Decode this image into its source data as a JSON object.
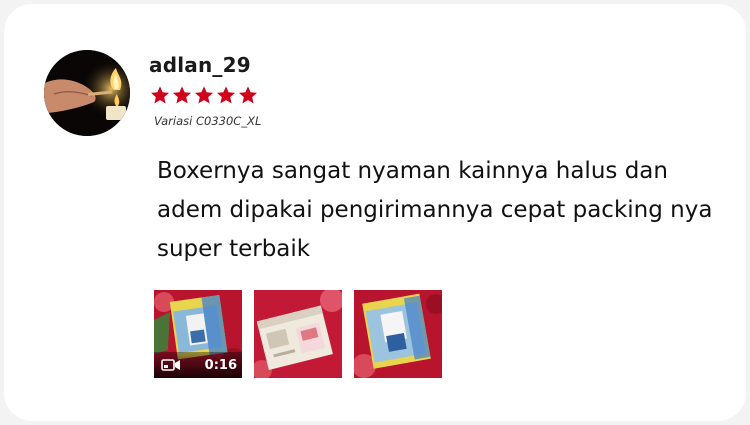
{
  "review": {
    "username": "adlan_29",
    "rating": 5,
    "rating_max": 5,
    "star_color": "#d0011b",
    "variation": "Variasi C0330C_XL",
    "text": "Boxernya sangat nyaman kainnya halus dan adem dipakai pengirimannya cepat packing nya super terbaik"
  },
  "avatar": {
    "icon": "lit-match-candle-photo"
  },
  "media": [
    {
      "kind": "video",
      "duration": "0:16",
      "icon": "video-camera-icon"
    },
    {
      "kind": "photo"
    },
    {
      "kind": "photo"
    }
  ]
}
